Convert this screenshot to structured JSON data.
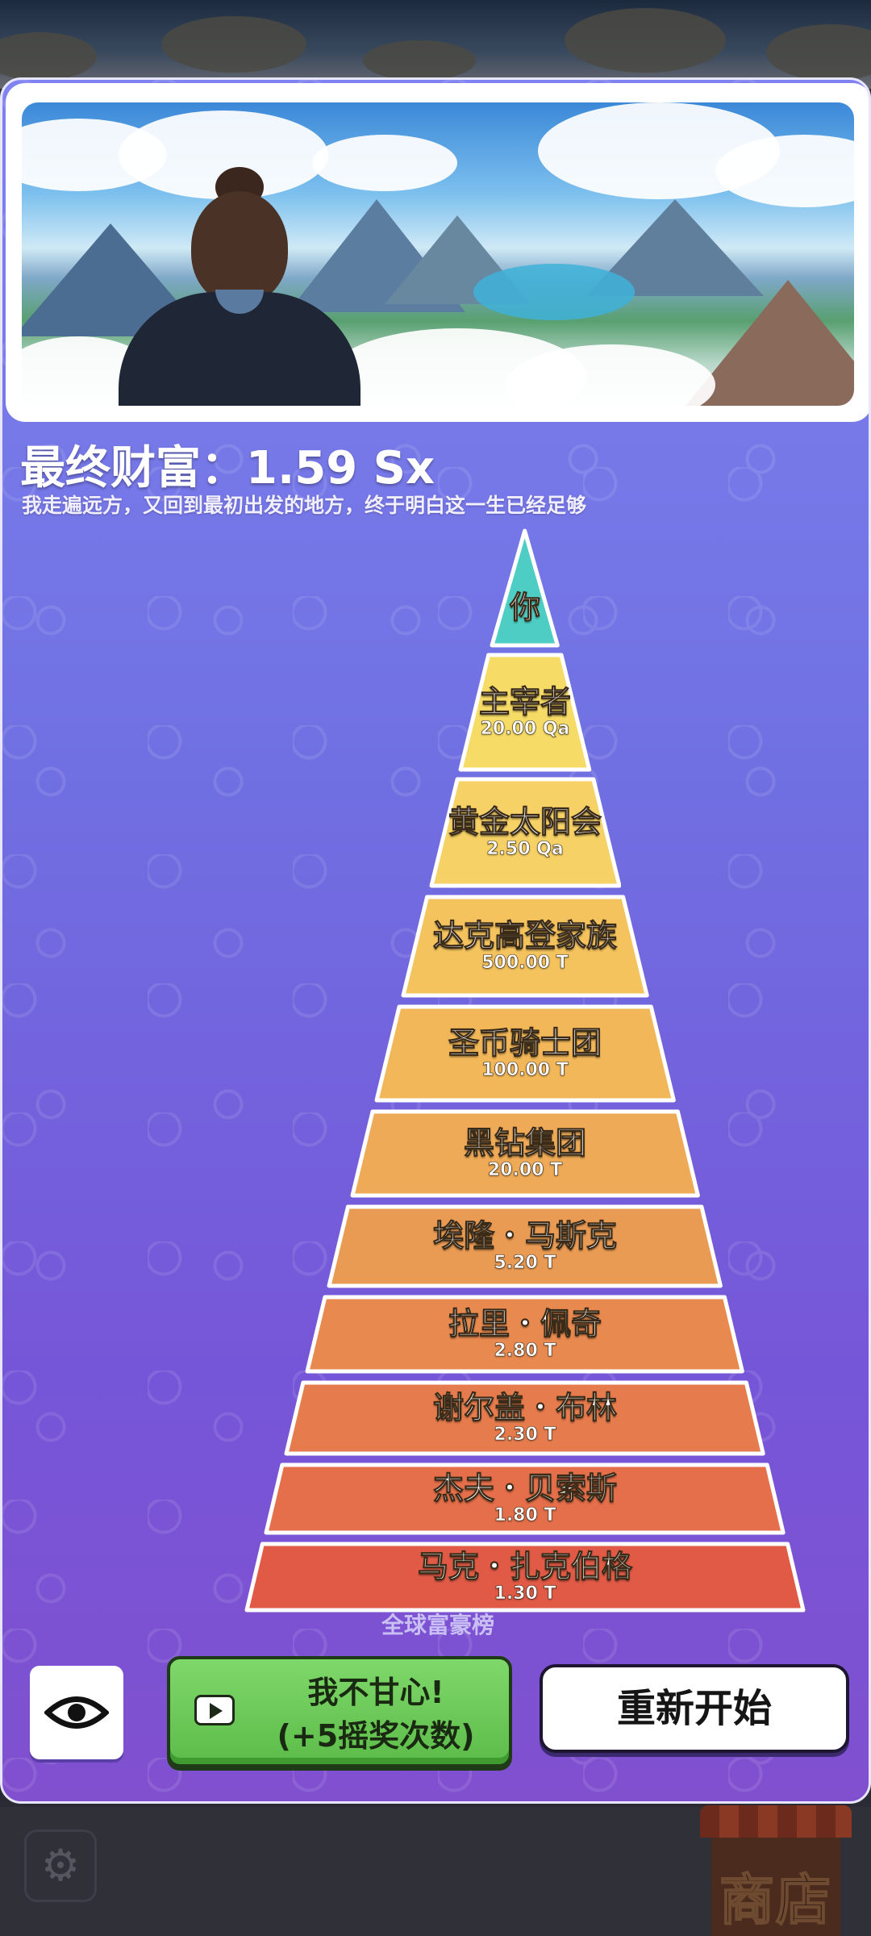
{
  "shop": {
    "label": "商店"
  },
  "result": {
    "final_wealth_label": "最终财富：",
    "final_wealth_value": "1.59 Sx",
    "subtitle": "我走遍远方，又回到最初出发的地方，终于明白这一生已经足够"
  },
  "pyramid": {
    "tiers": [
      {
        "name": "你",
        "value": "",
        "color": "#4ecdc4"
      },
      {
        "name": "主宰者",
        "value": "20.00 Qa",
        "color": "#f6dc66"
      },
      {
        "name": "黄金太阳会",
        "value": "2.50 Qa",
        "color": "#f6d165"
      },
      {
        "name": "达克高登家族",
        "value": "500.00 T",
        "color": "#f4c35d"
      },
      {
        "name": "圣币骑士团",
        "value": "100.00 T",
        "color": "#f2b758"
      },
      {
        "name": "黑钻集团",
        "value": "20.00 T",
        "color": "#eeaa56"
      },
      {
        "name": "埃隆・马斯克",
        "value": "5.20 T",
        "color": "#ea9b53"
      },
      {
        "name": "拉里・佩奇",
        "value": "2.80 T",
        "color": "#e88a50"
      },
      {
        "name": "谢尔盖・布林",
        "value": "2.30 T",
        "color": "#e67c4d"
      },
      {
        "name": "杰夫・贝索斯",
        "value": "1.80 T",
        "color": "#e46f4a"
      },
      {
        "name": "马克・扎克伯格",
        "value": "1.30 T",
        "color": "#e05a46"
      }
    ],
    "caption": "全球富豪榜"
  },
  "buttons": {
    "eye_icon": "eye-icon",
    "revive_line1": "我不甘心!",
    "revive_line2": "(+5摇奖次数)",
    "restart": "重新开始"
  }
}
